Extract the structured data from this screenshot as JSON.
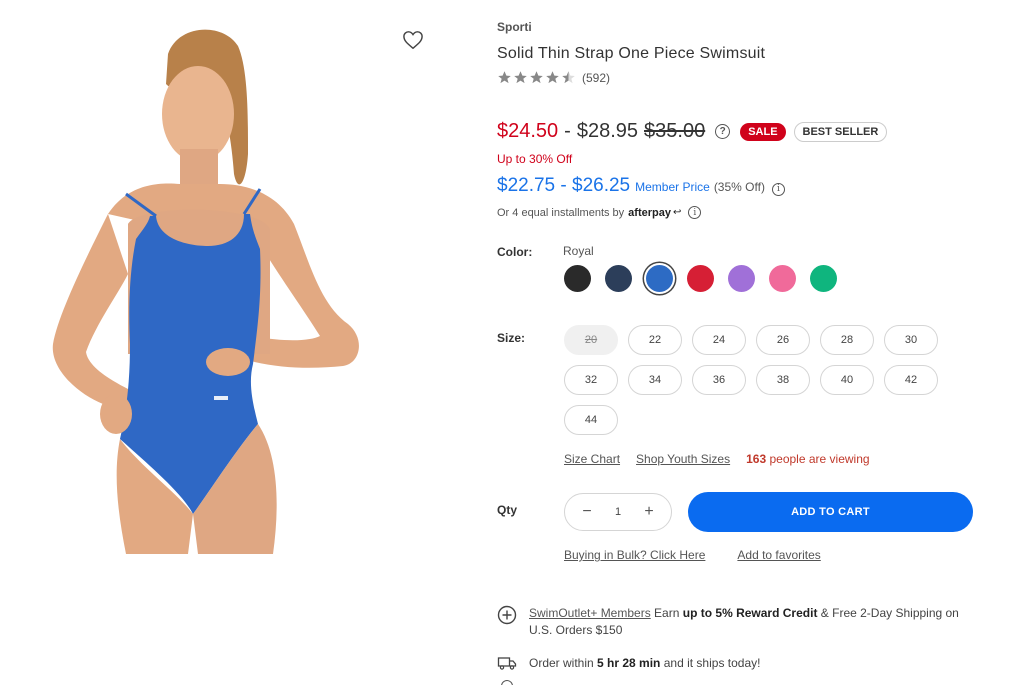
{
  "product": {
    "brand": "Sporti",
    "title": "Solid Thin Strap One Piece Swimsuit",
    "rating": 4.5,
    "review_count": "(592)"
  },
  "pricing": {
    "sale_low": "$24.50",
    "dash": "-",
    "sale_high": "$28.95",
    "original": "$35.00",
    "help_glyph": "?",
    "badge_sale": "SALE",
    "badge_best": "BEST SELLER",
    "discount": "Up to 30% Off",
    "member_range": "$22.75 - $26.25",
    "member_label": "Member Price",
    "member_off": "(35% Off)",
    "info_glyph": "i",
    "installments": "Or 4 equal installments by",
    "afterpay": "afterpay",
    "afterpay_arrow": "↩"
  },
  "color": {
    "label": "Color:",
    "selected_name": "Royal",
    "swatches": [
      {
        "name": "black",
        "hex": "#2a2a2a"
      },
      {
        "name": "navy",
        "hex": "#2c3e5a"
      },
      {
        "name": "royal",
        "hex": "#2d6bc4"
      },
      {
        "name": "red",
        "hex": "#d61f35"
      },
      {
        "name": "purple",
        "hex": "#a070d8"
      },
      {
        "name": "pink",
        "hex": "#f06a9a"
      },
      {
        "name": "green",
        "hex": "#0fb57e"
      }
    ],
    "selected_index": 2
  },
  "size": {
    "label": "Size:",
    "options": [
      "20",
      "22",
      "24",
      "26",
      "28",
      "30",
      "32",
      "34",
      "36",
      "38",
      "40",
      "42",
      "44"
    ],
    "sold_out": [
      "20"
    ]
  },
  "links": {
    "size_chart": "Size Chart",
    "youth_sizes": "Shop Youth Sizes",
    "viewing_count": "163",
    "viewing_text": "people are viewing",
    "bulk": "Buying in Bulk? Click Here",
    "favorites": "Add to favorites"
  },
  "cart": {
    "qty_label": "Qty",
    "minus": "−",
    "quantity": "1",
    "plus": "+",
    "add_to_cart": "ADD TO CART"
  },
  "perks": {
    "members_link": "SwimOutlet+ Members",
    "members_text1": "Earn",
    "members_bold": "up to 5% Reward Credit",
    "members_text2": "& Free 2-Day Shipping on U.S. Orders $150",
    "order_prefix": "Order within",
    "order_time": "5 hr 28 min",
    "order_suffix": "and it ships today!"
  },
  "colors": {
    "sale_red": "#d0021b",
    "member_blue": "#1a73e8",
    "cta_blue": "#0a6bf0"
  }
}
